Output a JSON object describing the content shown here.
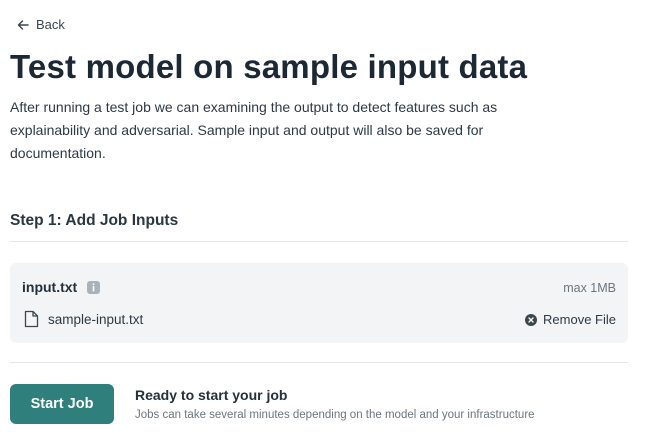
{
  "nav": {
    "back_label": "Back"
  },
  "header": {
    "title": "Test model on sample input data",
    "description": "After running a test job we can examining the output to detect features such as explainability and adversarial. Sample input and output will also be saved for documentation."
  },
  "step": {
    "title": "Step 1: Add Job Inputs"
  },
  "input": {
    "field_name": "input.txt",
    "max_size": "max 1MB",
    "file_name": "sample-input.txt",
    "remove_label": "Remove File"
  },
  "footer": {
    "start_button": "Start Job",
    "ready_title": "Ready to start your job",
    "ready_subtitle": "Jobs can take several minutes depending on the model and your infrastructure"
  },
  "colors": {
    "accent": "#2f7f7c",
    "card_background": "#f2f4f6",
    "divider": "#e4e8ec"
  }
}
